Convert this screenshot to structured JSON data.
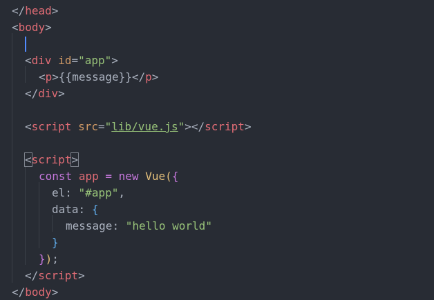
{
  "lines": {
    "l01": {
      "open": "</",
      "tag": "head",
      "close": ">"
    },
    "l02": {
      "open": "<",
      "tag": "body",
      "close": ">"
    },
    "l04": {
      "open": "<",
      "tag": "div",
      "attr": "id",
      "eq": "=",
      "val": "\"app\"",
      "close": ">"
    },
    "l05": {
      "open": "<",
      "tag": "p",
      "close": ">",
      "text": "{{message}}",
      "endopen": "</",
      "endtag": "p",
      "endclose": ">"
    },
    "l06": {
      "open": "</",
      "tag": "div",
      "close": ">"
    },
    "l08": {
      "open": "<",
      "tag": "script",
      "attr": "src",
      "eq": "=",
      "q1": "\"",
      "val": "lib/vue.js",
      "q2": "\"",
      "close": ">",
      "endopen": "</",
      "endtag": "script",
      "endclose": ">"
    },
    "l10": {
      "open": "<",
      "tag": "script",
      "close": ">"
    },
    "l11": {
      "kw": "const",
      "var": "app",
      "op": "=",
      "new": "new",
      "fn": "Vue",
      "paren": "(",
      "brace": "{"
    },
    "l12": {
      "key": "el",
      "colon": ":",
      "val": "\"#app\"",
      "comma": ","
    },
    "l13": {
      "key": "data",
      "colon": ":",
      "brace": "{"
    },
    "l14": {
      "key": "message",
      "colon": ":",
      "val": "\"hello world\""
    },
    "l15": {
      "brace": "}"
    },
    "l16": {
      "brace": "}",
      "paren": ")",
      "semi": ";"
    },
    "l17": {
      "open": "</",
      "tag": "script",
      "close": ">"
    },
    "l18": {
      "open": "</",
      "tag": "body",
      "close": ">"
    }
  },
  "colors": {
    "background": "#282c34",
    "tag": "#e06c75",
    "string": "#98c379",
    "keyword": "#c678dd",
    "attribute": "#d19a66",
    "cursor": "#528bff"
  }
}
